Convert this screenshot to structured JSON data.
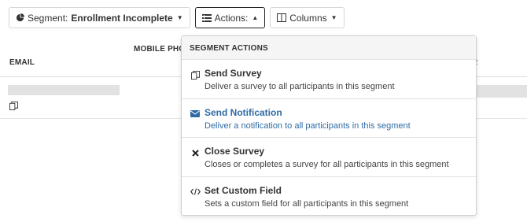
{
  "toolbar": {
    "segment_prefix": "Segment:",
    "segment_value": "Enrollment Incomplete",
    "actions_label": "Actions:",
    "columns_label": "Columns"
  },
  "table": {
    "header_email": "EMAIL",
    "header_mobile": "MOBILE PHONE",
    "header_right_fragment": "R"
  },
  "menu": {
    "header": "SEGMENT ACTIONS",
    "items": [
      {
        "icon": "copy-icon",
        "title": "Send Survey",
        "description": "Deliver a survey to all participants in this segment"
      },
      {
        "icon": "envelope-icon",
        "title": "Send Notification",
        "description": "Deliver a notification to all participants in this segment"
      },
      {
        "icon": "x-icon",
        "title": "Close Survey",
        "description": "Closes or completes a survey for all participants in this segment"
      },
      {
        "icon": "code-icon",
        "title": "Set Custom Field",
        "description": "Sets a custom field for all participants in this segment"
      }
    ]
  },
  "colors": {
    "highlight_text": "#2f6ba3",
    "border": "#d6d6d6",
    "redaction": "#e2e2e2"
  }
}
